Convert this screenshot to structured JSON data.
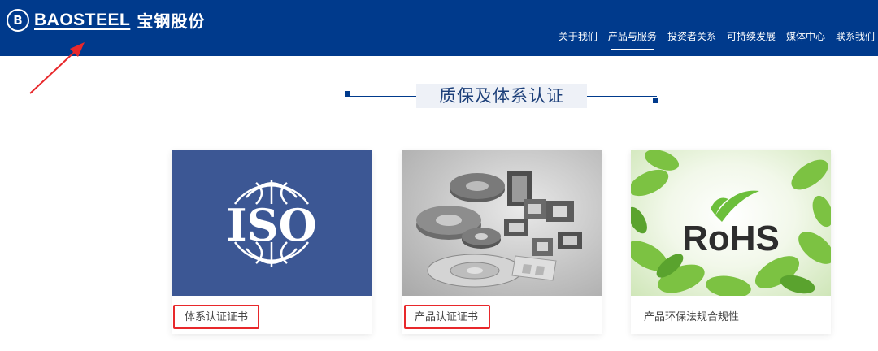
{
  "header": {
    "logo_mark": "B",
    "logo_en": "BAOSTEEL",
    "logo_cn": "宝钢股份",
    "background_color": "#003a8c"
  },
  "nav": {
    "items": [
      {
        "label": "关于我们"
      },
      {
        "label": "产品与服务",
        "active": true
      },
      {
        "label": "投资者关系"
      },
      {
        "label": "可持续发展"
      },
      {
        "label": "媒体中心"
      },
      {
        "label": "联系我们"
      }
    ]
  },
  "section": {
    "title": "质保及体系认证"
  },
  "cards": [
    {
      "caption": "体系认证证书",
      "image_text": "ISO",
      "highlighted": true
    },
    {
      "caption": "产品认证证书",
      "image_text": "",
      "highlighted": true
    },
    {
      "caption": "产品环保法规合规性",
      "image_text": "RoHS",
      "highlighted": false
    }
  ],
  "colors": {
    "highlight": "#e8282b",
    "accent": "#003a8c"
  }
}
